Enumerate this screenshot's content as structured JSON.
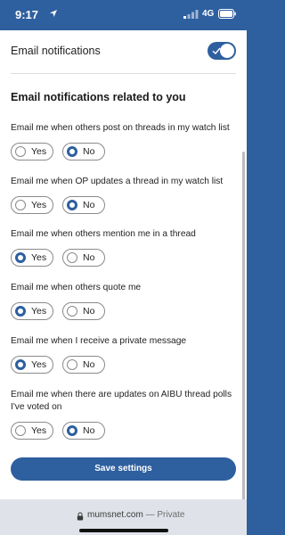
{
  "status_bar": {
    "time": "9:17",
    "network": "4G"
  },
  "header": {
    "toggle_label": "Email notifications",
    "toggle_on": true
  },
  "section_title": "Email notifications related to you",
  "options": {
    "yes": "Yes",
    "no": "No"
  },
  "questions": [
    {
      "label": "Email me when others post on threads in my watch list",
      "selected": "No"
    },
    {
      "label": "Email me when OP updates a thread in my watch list",
      "selected": "No"
    },
    {
      "label": "Email me when others mention me in a thread",
      "selected": "Yes"
    },
    {
      "label": "Email me when others quote me",
      "selected": "Yes"
    },
    {
      "label": "Email me when I receive a private message",
      "selected": "Yes"
    },
    {
      "label": "Email me when there are updates on AIBU thread polls I've voted on",
      "selected": "No"
    }
  ],
  "save_button": "Save settings",
  "browser": {
    "domain": "mumsnet.com",
    "separator": "—",
    "mode": "Private"
  },
  "colors": {
    "accent": "#2e5f9f",
    "bottom_bar": "#dfe3e9"
  },
  "icons": {
    "arrow": "location-arrow-icon",
    "signal": "signal-bars-icon",
    "battery": "battery-icon",
    "lock": "lock-icon",
    "check": "check-icon"
  }
}
